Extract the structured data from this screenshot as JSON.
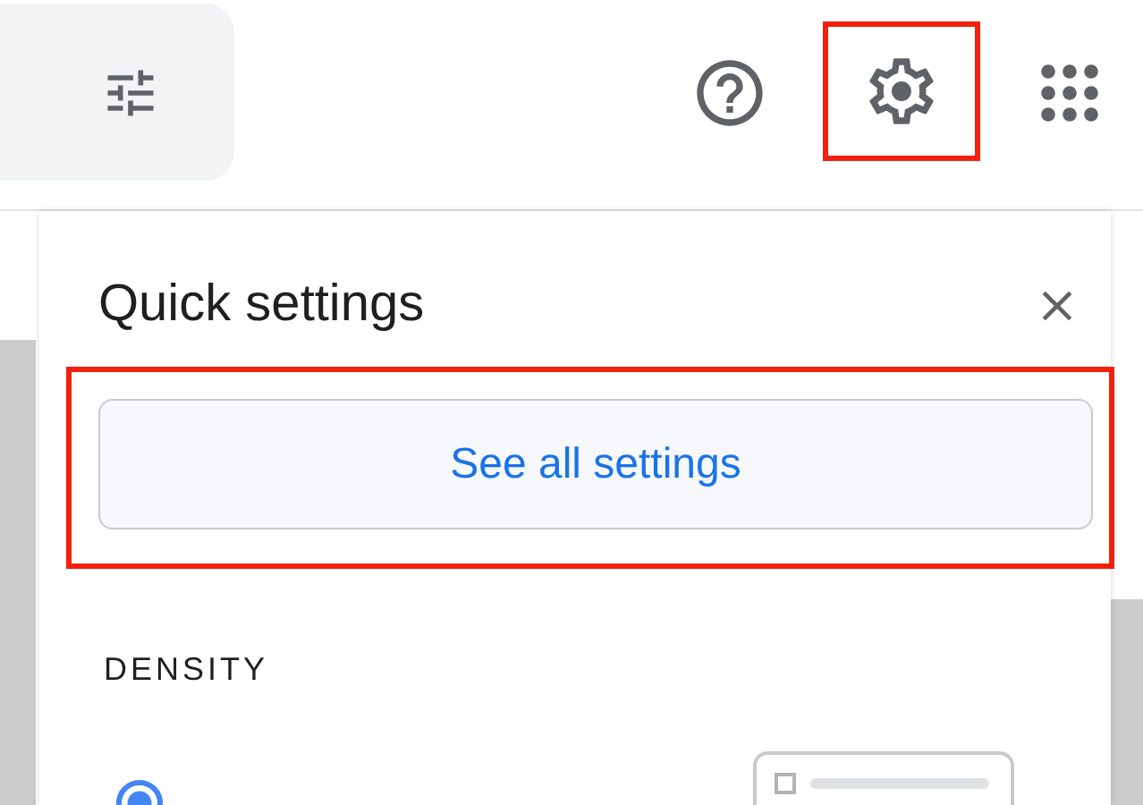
{
  "toolbar_icons": [
    {
      "kind": "help",
      "highlighted": false
    },
    {
      "kind": "settings",
      "highlighted": true
    },
    {
      "kind": "apps",
      "highlighted": false
    }
  ],
  "quick_settings": {
    "title": "Quick settings",
    "see_all_button": {
      "label": "See all settings",
      "highlighted": true
    },
    "density": {
      "heading": "DENSITY",
      "options": [
        {
          "selected": true
        }
      ]
    }
  }
}
